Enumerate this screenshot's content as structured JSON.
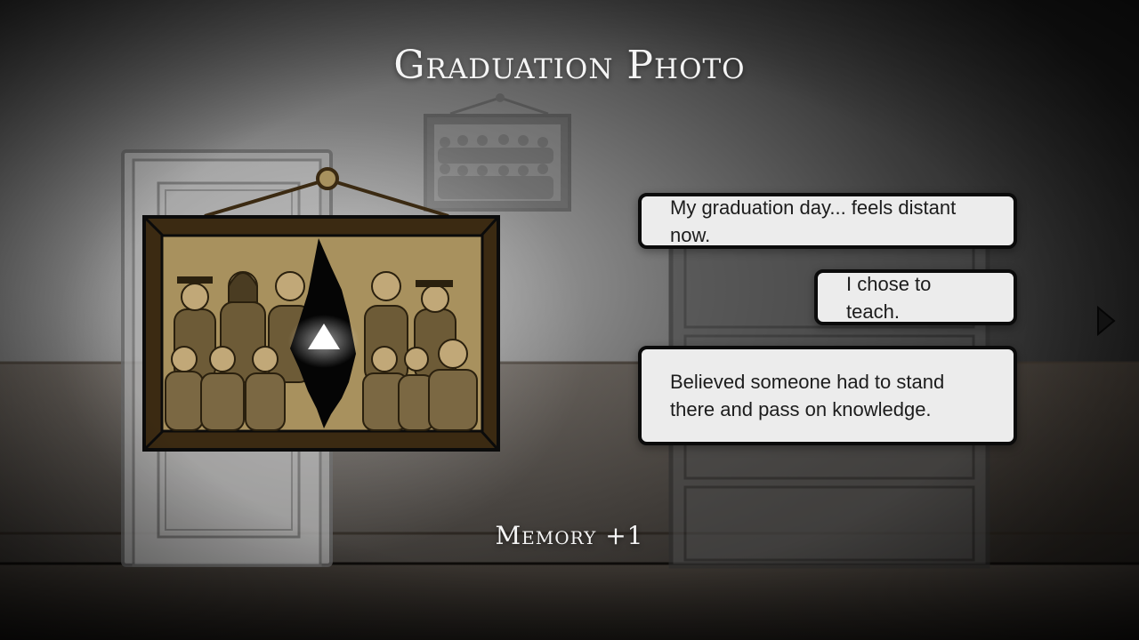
{
  "scene": {
    "title": "Graduation Photo",
    "reward": "Memory +1"
  },
  "dialogue": [
    {
      "text": "My graduation day... feels distant now."
    },
    {
      "text": "I chose to teach."
    },
    {
      "text": "Believed someone had to stand there and pass on knowledge."
    }
  ],
  "icons": {
    "nav": "play-right-arrow-icon",
    "interact": "triangle-up-icon"
  },
  "colors": {
    "wall": "#5a5a5a",
    "frame_wood": "#3b2a12",
    "photo_sepia": "#a8915e",
    "bubble_bg": "#ececec",
    "bubble_border": "#0b0b0b",
    "title_text": "#f4f4f4"
  }
}
